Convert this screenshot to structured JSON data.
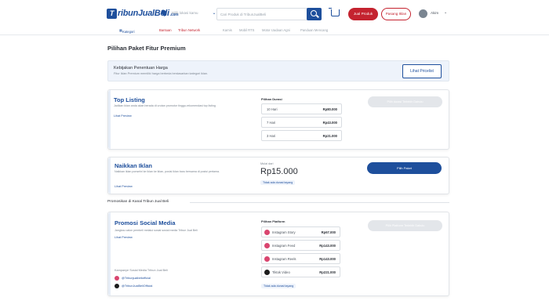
{
  "header": {
    "logo_mark": "T",
    "logo_text": "ribunJualBeli",
    "logo_suffix": ".com",
    "location_placeholder": "Pilih lokasi kamu",
    "search_placeholder": "Cari Produk di TribunJualBeli",
    "jual_produk_label": "Jual Produk",
    "pasang_iklan_label": "Pasang Iklan",
    "user_name": "Akim",
    "brand_color": "#1e4f9c",
    "accent_color": "#c4232f"
  },
  "nav": {
    "kategori": "Kategori",
    "links": [
      "Bantuan",
      "Tribun Network"
    ],
    "grey_links": [
      "Karnis",
      "Mobil RTS",
      "Motor Uadaan Agni",
      "Panduan Mencang"
    ]
  },
  "page_title": "Pilihan Paket Fitur Premium",
  "policy": {
    "title": "Kebijakan Penentuan Harga",
    "subtitle": "Fitur Iklan Premium memiliki harga berbeda berdasarkan kategori iklan.",
    "button": "Lihat Pricelist"
  },
  "top_listing": {
    "title": "Top Listing",
    "desc": "Jadikan iklan anda akan berada di urutan promotor tinggu-rekomendasi top listing",
    "preview": "Lihat Preview",
    "group_label": "Pilihan Durasi",
    "options": [
      {
        "label": "10 Hari",
        "price": "Rp80.000"
      },
      {
        "label": "7 Hari",
        "price": "Rp43.000"
      },
      {
        "label": "3 Hari",
        "price": "Rp21.000"
      }
    ],
    "button": "Pilih durasi Terlebih Dahulu"
  },
  "naikkan": {
    "title": "Naikkan Iklan",
    "desc": "Naikkan iklan ponselnl ke iklan ke iklan, posisi iklan baru bersama di posisi pertama.",
    "preview": "Lihat Preview",
    "price_label": "Mulai dari",
    "price": "Rp15.000",
    "tag": "Tidak ada durasi tayang",
    "button": "Pilih Paket"
  },
  "section_title": "Promosikan di Kanal Tribun Jual Beli",
  "promosi": {
    "title": "Promosi Social Media",
    "desc": "Jangkau calon pembeli melalui sosial sosial media Tribun Jual Beli",
    "preview": "Lihat Preview",
    "group_label": "Pilihan Platform",
    "options": [
      {
        "icon": "instagram-icon",
        "label": "Instagram Story",
        "price": "Rp67.000"
      },
      {
        "icon": "instagram-icon",
        "label": "Instagram Feed",
        "price": "Rp143.000"
      },
      {
        "icon": "instagram-icon",
        "label": "Instagram Reels",
        "price": "Rp143.000"
      },
      {
        "icon": "tiktok-icon",
        "label": "Tiktok Video",
        "price": "Rp221.000"
      }
    ],
    "tag": "Tidak ada durasi tayang",
    "button": "Pilih Platform Terlebih Dahulu",
    "account_label": "Kampanye Sosial Media Tribun Jual Beli",
    "accounts": [
      "@Tribunjualbeliofficial",
      "@TribunJualBeliOfficial"
    ]
  }
}
